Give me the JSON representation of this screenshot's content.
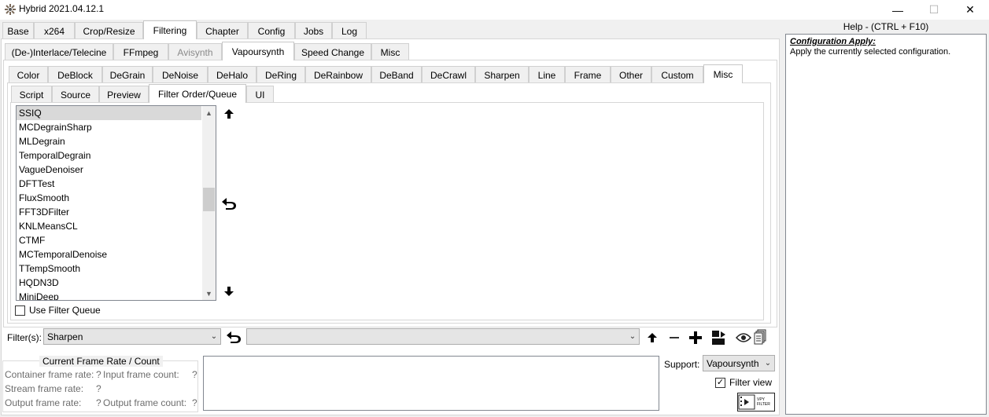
{
  "window": {
    "title": "Hybrid 2021.04.12.1",
    "minimize_glyph": "—",
    "maximize_glyph": "☐",
    "close_glyph": "✕"
  },
  "main_tabs": [
    "Base",
    "x264",
    "Crop/Resize",
    "Filtering",
    "Chapter",
    "Config",
    "Jobs",
    "Log"
  ],
  "sub_tabs": [
    "(De-)Interlace/Telecine",
    "FFmpeg",
    "Avisynth",
    "Vapoursynth",
    "Speed Change",
    "Misc"
  ],
  "vs_tabs": [
    "Color",
    "DeBlock",
    "DeGrain",
    "DeNoise",
    "DeHalo",
    "DeRing",
    "DeRainbow",
    "DeBand",
    "DeCrawl",
    "Sharpen",
    "Line",
    "Frame",
    "Other",
    "Custom",
    "Misc"
  ],
  "misc_tabs": [
    "Script",
    "Source",
    "Preview",
    "Filter Order/Queue",
    "UI"
  ],
  "filter_list": [
    "SSIQ",
    "MCDegrainSharp",
    "MLDegrain",
    "TemporalDegrain",
    "VagueDenoiser",
    "DFTTest",
    "FluxSmooth",
    "FFT3DFilter",
    "KNLMeansCL",
    "CTMF",
    "MCTemporalDenoise",
    "TTempSmooth",
    "HQDN3D",
    "MiniDeep"
  ],
  "use_filter_queue_label": "Use Filter Queue",
  "filters": {
    "label": "Filter(s):",
    "selected": "Sharpen",
    "secondary_value": ""
  },
  "frame_info": {
    "title": "Current Frame Rate / Count",
    "container_frame_rate_label": "Container frame rate:",
    "container_frame_rate_value": "?",
    "input_frame_count_label": "Input frame count:",
    "input_frame_count_value": "?",
    "stream_frame_rate_label": "Stream frame rate:",
    "stream_frame_rate_value": "?",
    "output_frame_rate_label": "Output frame rate:",
    "output_frame_rate_value": "?",
    "output_frame_count_label": "Output frame count:",
    "output_frame_count_value": "?"
  },
  "support": {
    "label": "Support:",
    "selected": "Vapoursynth",
    "filter_view_label": "Filter view",
    "filter_view_checked": true,
    "vpy_badge": "VPY FILTER"
  },
  "help": {
    "title": "Help - (CTRL + F10)",
    "heading": "Configuration Apply:",
    "text": "Apply the currently selected configuration."
  }
}
